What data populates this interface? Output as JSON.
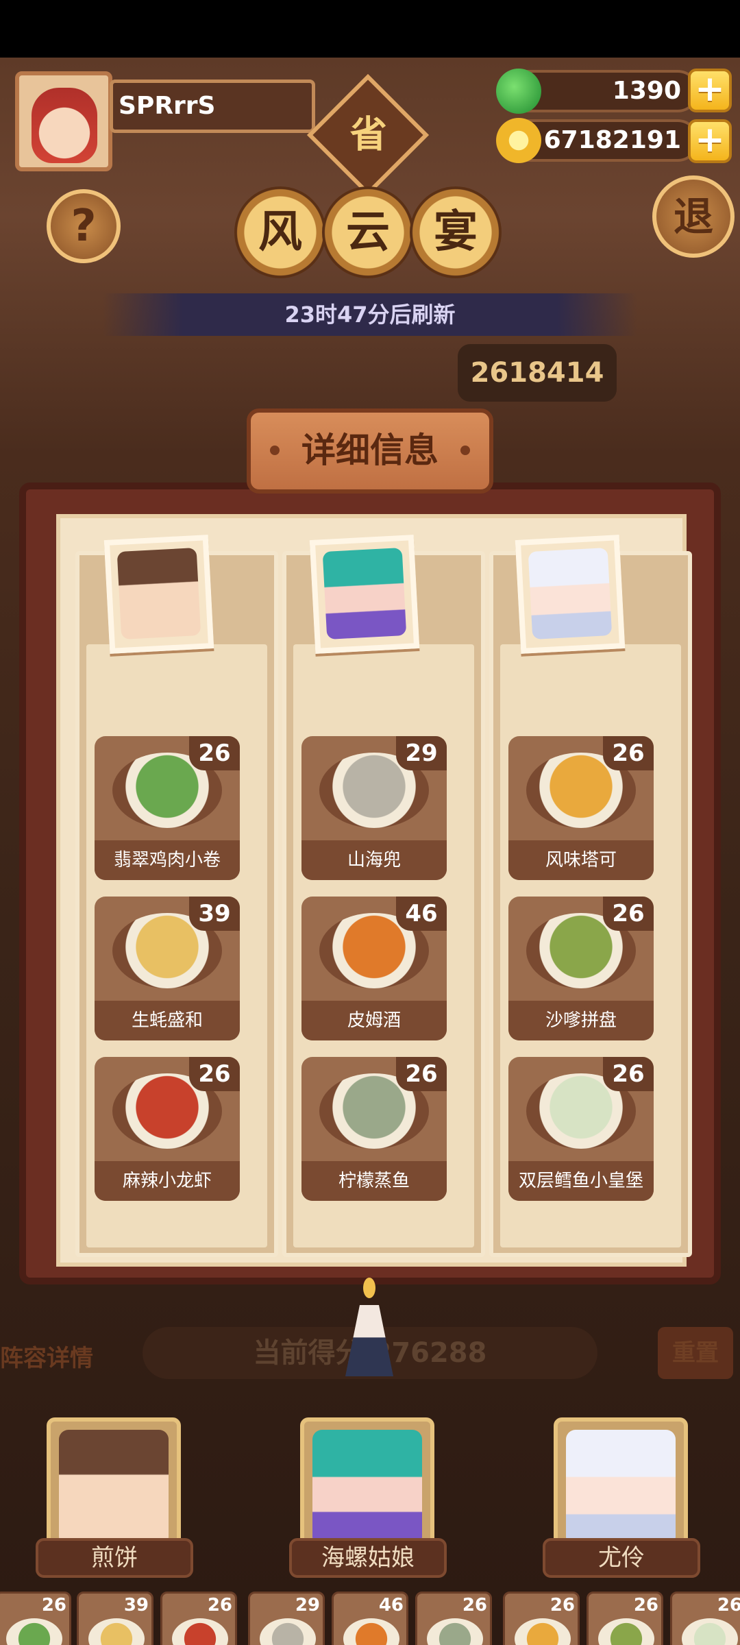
{
  "player": {
    "name": "SPRrrS"
  },
  "resources": {
    "jade": "1390",
    "coins": "67182191",
    "plus": "+"
  },
  "top_buttons": {
    "help": "?",
    "exit": "退",
    "province": "省"
  },
  "event": {
    "title_chars": [
      "风",
      "云",
      "宴"
    ],
    "refresh_text": "23时47分后刷新",
    "score_plate": "2618414"
  },
  "panel": {
    "title": "详细信息",
    "columns": [
      {
        "dishes": [
          {
            "name": "翡翠鸡肉小卷",
            "count": "26",
            "color": "#6aa84f"
          },
          {
            "name": "生蚝盛和",
            "count": "39",
            "color": "#e8c063"
          },
          {
            "name": "麻辣小龙虾",
            "count": "26",
            "color": "#c8412c"
          }
        ]
      },
      {
        "dishes": [
          {
            "name": "山海兜",
            "count": "29",
            "color": "#b8b3a6"
          },
          {
            "name": "皮姆酒",
            "count": "46",
            "color": "#e07a2a"
          },
          {
            "name": "柠檬蒸鱼",
            "count": "26",
            "color": "#9aa88a"
          }
        ]
      },
      {
        "dishes": [
          {
            "name": "风味塔可",
            "count": "26",
            "color": "#e9a93d"
          },
          {
            "name": "沙嗲拼盘",
            "count": "26",
            "color": "#8aa64a"
          },
          {
            "name": "双层鳕鱼小皇堡",
            "count": "26",
            "color": "#d7e3c4"
          }
        ]
      }
    ]
  },
  "bottom": {
    "lineup_label": "阵容详情",
    "current_score": "当前得分 276288",
    "reset": "重置",
    "heroes": [
      {
        "name": "煎饼"
      },
      {
        "name": "海螺姑娘"
      },
      {
        "name": "尤伶"
      }
    ],
    "strip_counts": [
      "26",
      "39",
      "26",
      "29",
      "46",
      "26",
      "26",
      "26",
      "26"
    ],
    "strip_colors": [
      "#6aa84f",
      "#e8c063",
      "#c8412c",
      "#b8b3a6",
      "#e07a2a",
      "#9aa88a",
      "#e9a93d",
      "#8aa64a",
      "#d7e3c4"
    ]
  }
}
